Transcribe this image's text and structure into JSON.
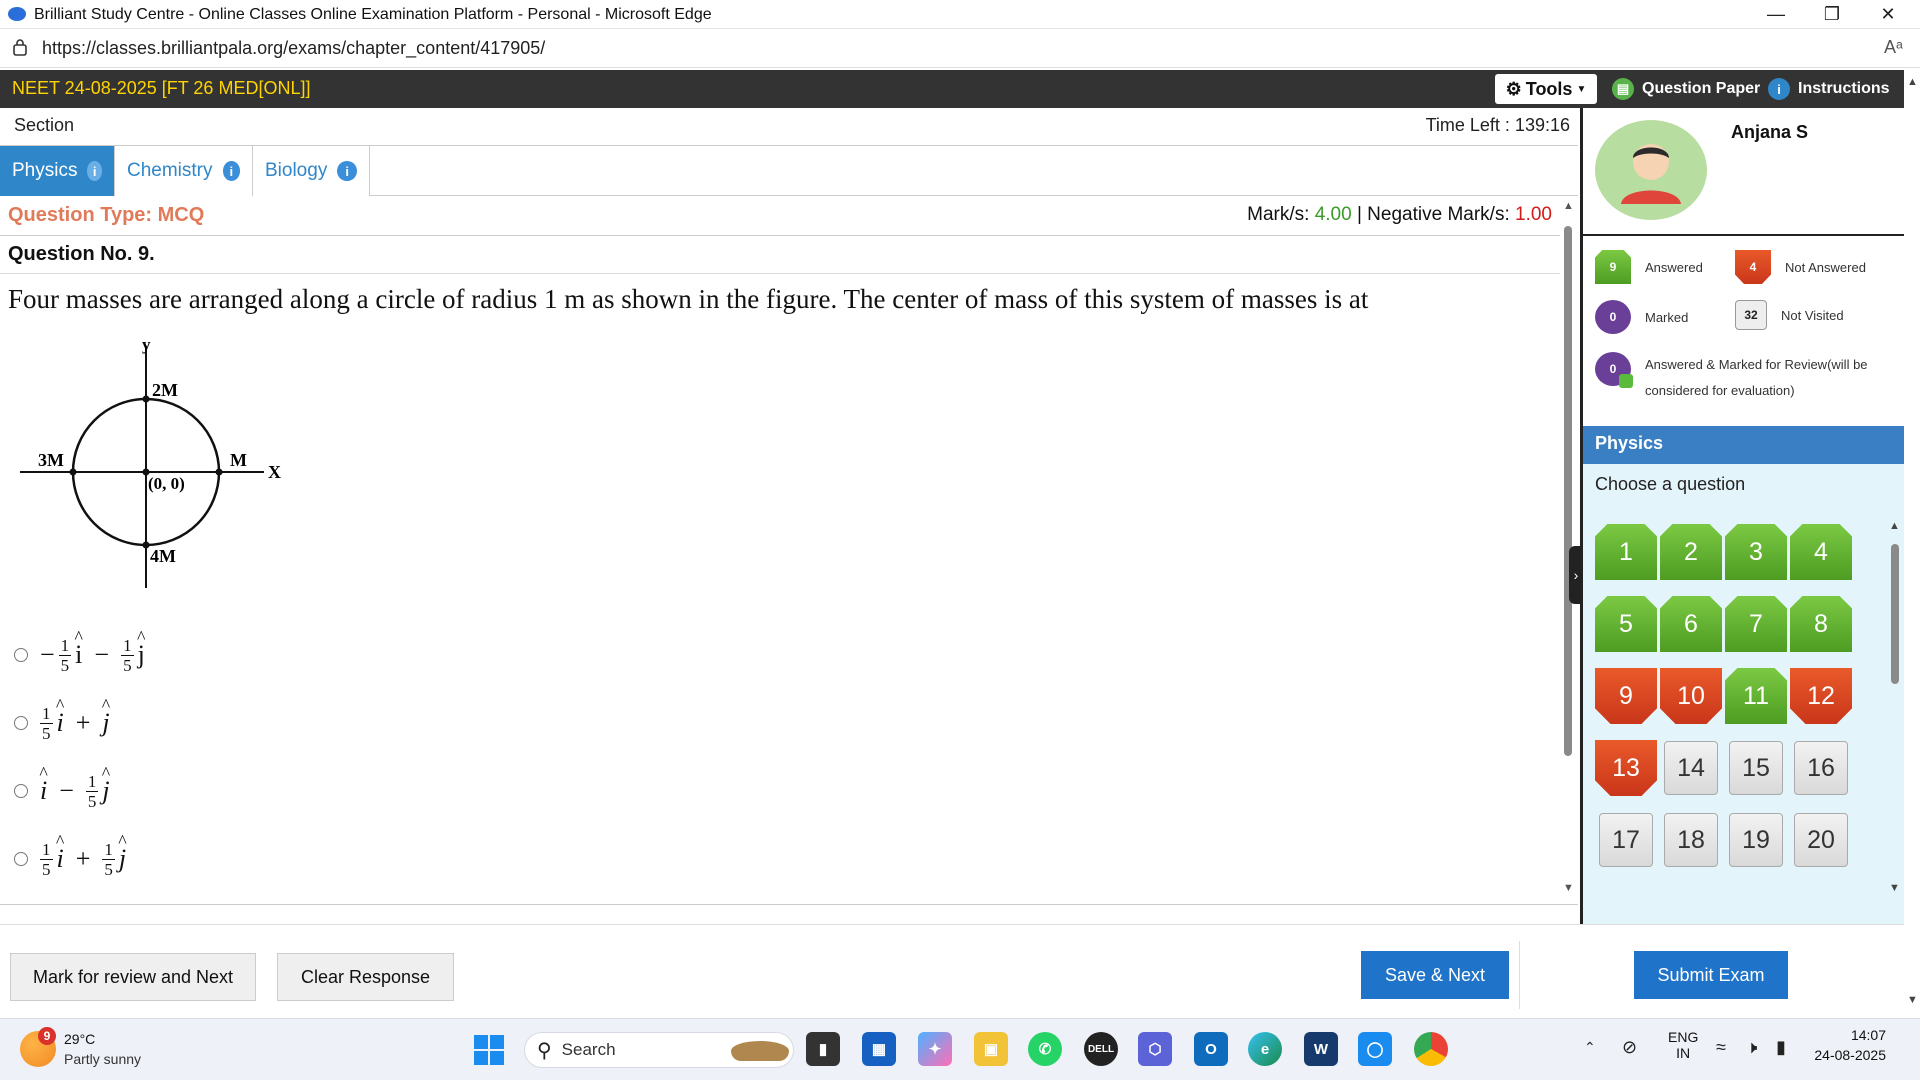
{
  "browser": {
    "title": "Brilliant Study Centre - Online Classes Online Examination Platform - Personal - Microsoft Edge",
    "url": "https://classes.brilliantpala.org/exams/chapter_content/417905/",
    "read_aloud": "Aᵃ"
  },
  "exam_header": {
    "title": "NEET 24-08-2025 [FT 26 MED[ONL]]",
    "tools_label": "Tools",
    "question_paper_label": "Question Paper",
    "instructions_label": "Instructions"
  },
  "section": {
    "label": "Section",
    "time_left": "Time Left : 139:16",
    "tabs": [
      {
        "label": "Physics",
        "active": true
      },
      {
        "label": "Chemistry",
        "active": false
      },
      {
        "label": "Biology",
        "active": false
      }
    ]
  },
  "question": {
    "type_label": "Question Type: MCQ",
    "marks_label": "Mark/s:",
    "marks_value": "4.00",
    "neg_label": "| Negative Mark/s:",
    "neg_value": "1.00",
    "number": "Question No. 9.",
    "text": "Four masses are arranged along a circle of radius 1 m as shown in the figure. The center of mass of this system of masses is at",
    "figure_labels": {
      "y": "y",
      "x": "X",
      "top": "2M",
      "left": "3M",
      "right": "M",
      "bottom": "4M",
      "origin": "(0, 0)"
    },
    "options": [
      {
        "parts": [
          "−",
          "1/5",
          "i",
          "−",
          "1/5",
          "j"
        ]
      },
      {
        "parts": [
          "1/5",
          "i",
          "+",
          "j"
        ]
      },
      {
        "parts": [
          "i",
          "−",
          "1/5",
          "j"
        ]
      },
      {
        "parts": [
          "1/5",
          "i",
          "+",
          "1/5",
          "j"
        ]
      }
    ]
  },
  "actions": {
    "mark_review": "Mark for review and Next",
    "clear": "Clear Response",
    "save_next": "Save & Next",
    "submit": "Submit Exam"
  },
  "profile": {
    "name": "Anjana S"
  },
  "legend": {
    "answered_count": "9",
    "answered_label": "Answered",
    "not_answered_count": "4",
    "not_answered_label": "Not Answered",
    "marked_count": "0",
    "marked_label": "Marked",
    "not_visited_count": "32",
    "not_visited_label": "Not Visited",
    "ans_marked_count": "0",
    "ans_marked_label": "Answered & Marked for Review(will be considered for evaluation)"
  },
  "palette": {
    "section_title": "Physics",
    "choose_label": "Choose a question",
    "questions": [
      {
        "n": "1",
        "status": "answered"
      },
      {
        "n": "2",
        "status": "answered"
      },
      {
        "n": "3",
        "status": "answered"
      },
      {
        "n": "4",
        "status": "answered"
      },
      {
        "n": "5",
        "status": "answered"
      },
      {
        "n": "6",
        "status": "answered"
      },
      {
        "n": "7",
        "status": "answered"
      },
      {
        "n": "8",
        "status": "answered"
      },
      {
        "n": "9",
        "status": "notanswered"
      },
      {
        "n": "10",
        "status": "notanswered"
      },
      {
        "n": "11",
        "status": "answered"
      },
      {
        "n": "12",
        "status": "notanswered"
      },
      {
        "n": "13",
        "status": "notanswered"
      },
      {
        "n": "14",
        "status": "notvisited"
      },
      {
        "n": "15",
        "status": "notvisited"
      },
      {
        "n": "16",
        "status": "notvisited"
      },
      {
        "n": "17",
        "status": "notvisited"
      },
      {
        "n": "18",
        "status": "notvisited"
      },
      {
        "n": "19",
        "status": "notvisited"
      },
      {
        "n": "20",
        "status": "notvisited"
      }
    ]
  },
  "taskbar": {
    "weather_temp": "29°C",
    "weather_desc": "Partly sunny",
    "weather_badge": "9",
    "search_placeholder": "Search",
    "lang_top": "ENG",
    "lang_bottom": "IN",
    "time": "14:07",
    "date": "24-08-2025"
  },
  "colors": {
    "exam_title": "#ffd400",
    "marks_green": "#3a9a2a",
    "neg_red": "#d11a1a",
    "tab_active": "#2f86c9",
    "section_head": "#3a7fc4",
    "submit_blue": "#1f73c8"
  }
}
